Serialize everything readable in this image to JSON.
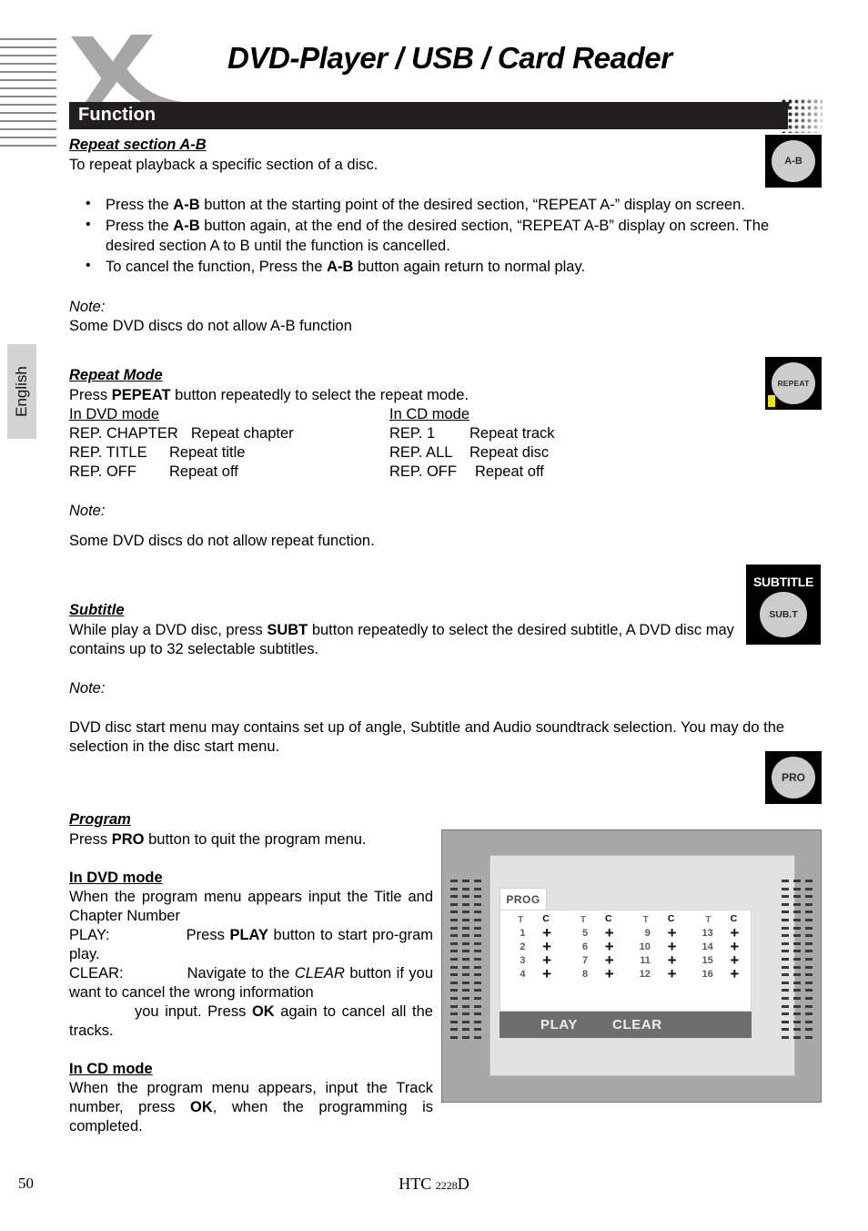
{
  "header": {
    "title": "DVD-Player / USB / Card Reader",
    "section_label": "Function",
    "logo_icon": "x-brand-logo"
  },
  "sidebar": {
    "language_tab": "English"
  },
  "sections": {
    "repeat_ab": {
      "heading": "Repeat section A-B",
      "intro": "To repeat playback a specific section of a disc.",
      "bullets": [
        {
          "pre": "Press the ",
          "key": "A-B",
          "post": " button at the starting point of the desired section, “REPEAT A-” display on screen."
        },
        {
          "pre": "Press the ",
          "key": "A-B",
          "post": " button again, at the end of the desired section, “REPEAT A-B” display on screen. The desired section A to B until the function is cancelled."
        },
        {
          "pre": "To cancel the function, Press the ",
          "key": "A-B",
          "post": " button again return to normal play."
        }
      ],
      "note_label": "Note:",
      "note_text": "Some DVD discs do not allow A-B function",
      "key_icon": {
        "name": "remote-key-ab",
        "label": "A-B"
      }
    },
    "repeat_mode": {
      "heading": "Repeat Mode",
      "intro_pre": "Press ",
      "intro_key": "PEPEAT",
      "intro_post": " button repeatedly to select the repeat mode.",
      "col_head_left": "In DVD mode",
      "col_head_right": "In CD mode",
      "rows": [
        {
          "dvd_key": "REP. CHAPTER",
          "dvd_val": "Repeat chapter",
          "cd_key": "REP. 1",
          "cd_val": "Repeat track"
        },
        {
          "dvd_key": "REP. TITLE",
          "dvd_val": "Repeat title",
          "cd_key": "REP. ALL",
          "cd_val": "Repeat disc"
        },
        {
          "dvd_key": "REP. OFF",
          "dvd_val": "Repeat off",
          "cd_key": "REP. OFF",
          "cd_val": "Repeat off"
        }
      ],
      "note_label": "Note:",
      "note_text": "Some DVD discs do not allow repeat function.",
      "key_icon": {
        "name": "remote-key-repeat",
        "label": "REPEAT",
        "tag_color": "#f2e500"
      }
    },
    "subtitle": {
      "heading": "Subtitle",
      "body_pre": "While play a DVD disc, press ",
      "body_key": "SUBT",
      "body_post": " button repeatedly to select the desired subtitle, A DVD disc may contains up to 32 selectable subtitles.",
      "note_label": "Note:",
      "note_text": "DVD disc start menu may contains set up of angle, Subtitle and Audio soundtrack selection. You may do the selection in the disc start menu.",
      "key_icon": {
        "name": "remote-key-subtitle",
        "cap_label": "SUBTITLE",
        "label": "SUB.T"
      }
    },
    "program": {
      "heading": "Program",
      "intro_pre": "Press ",
      "intro_key": "PRO",
      "intro_post": " button to quit the program  menu.",
      "dvd_heading": "In DVD mode",
      "dvd_line1": "When the program menu appears input the Title and Chapter Number",
      "dvd_play_label": "PLAY:",
      "dvd_play_pre": "Press ",
      "dvd_play_key": "PLAY",
      "dvd_play_post": " button to start pro-gram play.",
      "dvd_clear_label": "CLEAR:",
      "dvd_clear_pre": "Navigate to the ",
      "dvd_clear_em": "CLEAR",
      "dvd_clear_post": " button if you want to cancel the wrong information",
      "dvd_clear_line2_pre": "you input. Press ",
      "dvd_clear_line2_key": "OK",
      "dvd_clear_line2_post": " again to cancel all the tracks.",
      "cd_heading": "In CD mode",
      "cd_pre": "When the program menu appears, input the Track number, press ",
      "cd_key": "OK",
      "cd_post": ", when the programming is completed.",
      "key_icon": {
        "name": "remote-key-pro",
        "label": "PRO"
      }
    }
  },
  "program_screenshot": {
    "name": "program-menu-osd",
    "tab_label": "PROG",
    "column_headers": [
      "T",
      "C"
    ],
    "column_groups": 4,
    "entries": [
      {
        "num": "1",
        "mark": "+"
      },
      {
        "num": "2",
        "mark": "+"
      },
      {
        "num": "3",
        "mark": "+"
      },
      {
        "num": "4",
        "mark": "+"
      },
      {
        "num": "5",
        "mark": "+"
      },
      {
        "num": "6",
        "mark": "+"
      },
      {
        "num": "7",
        "mark": "+"
      },
      {
        "num": "8",
        "mark": "+"
      },
      {
        "num": "9",
        "mark": "+"
      },
      {
        "num": "10",
        "mark": "+"
      },
      {
        "num": "11",
        "mark": "+"
      },
      {
        "num": "12",
        "mark": "+"
      },
      {
        "num": "13",
        "mark": "+"
      },
      {
        "num": "14",
        "mark": "+"
      },
      {
        "num": "15",
        "mark": "+"
      },
      {
        "num": "16",
        "mark": "+"
      }
    ],
    "play_button": "PLAY",
    "clear_button": "CLEAR"
  },
  "footer": {
    "page_number": "50",
    "model_prefix": "HTC",
    "model_digits": "2228",
    "model_suffix": "D"
  },
  "colors": {
    "section_bar": "#231f20",
    "brand_gray": "#a6a6a6",
    "tab_gray": "#d3d3d3",
    "osd_bar": "#6e6e6e",
    "highlight_yellow": "#f2e500"
  }
}
